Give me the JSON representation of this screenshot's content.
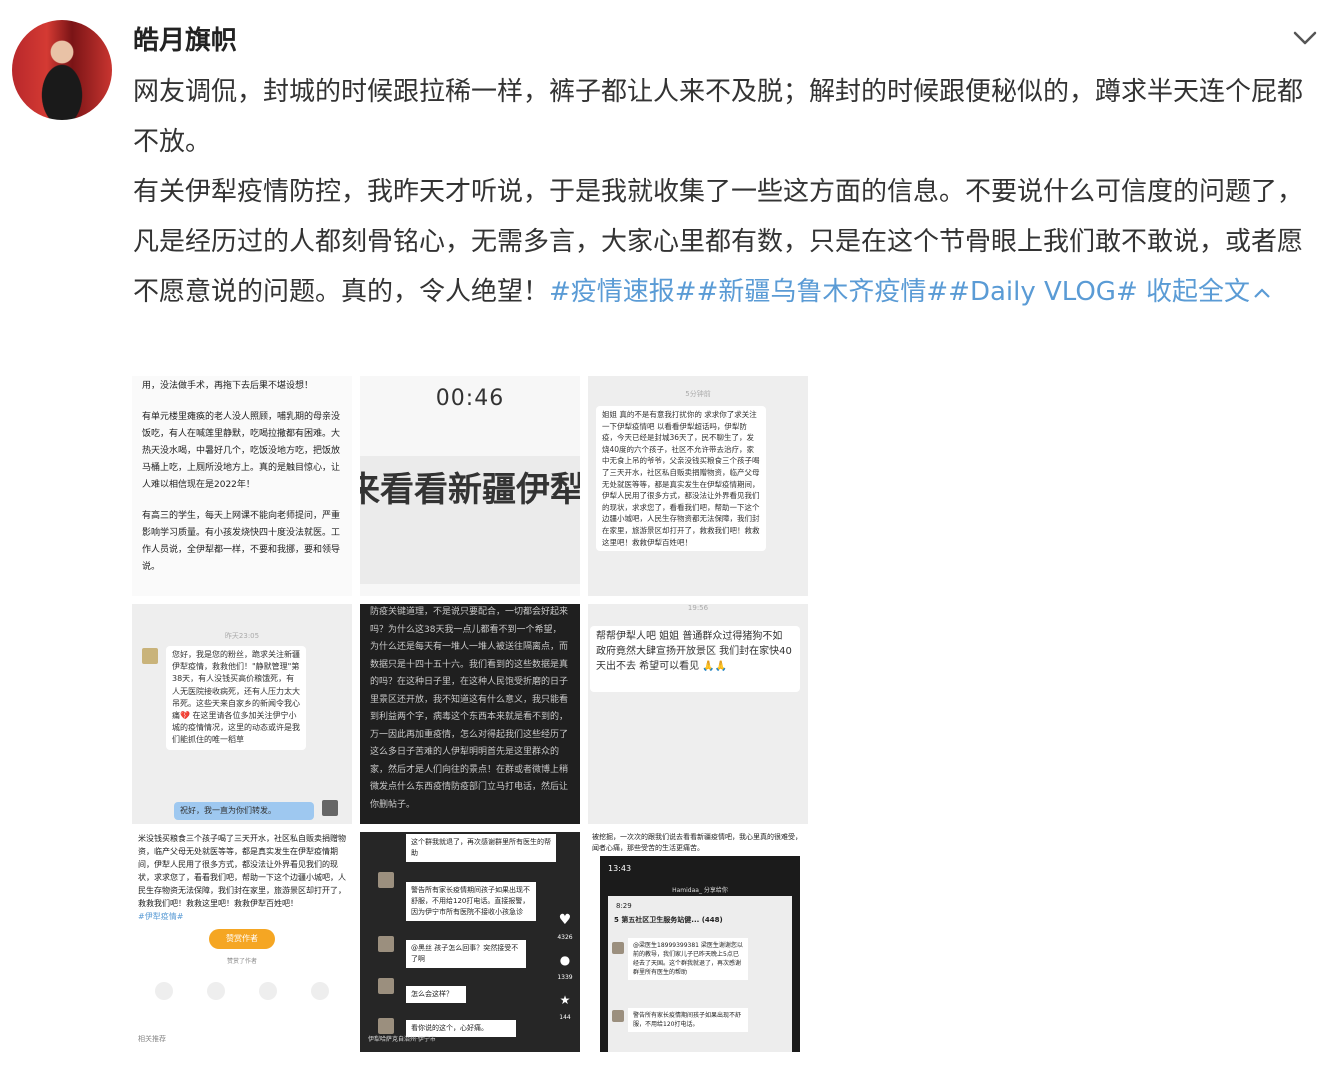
{
  "user": {
    "name": "皓月旗帜"
  },
  "post": {
    "line1": "网友调侃，封城的时候跟拉稀一样，裤子都让人来不及脱；解封的时候跟便秘似的，蹲求半天连个屁都不放。",
    "line2_text": "有关伊犁疫情防控，我昨天才听说，于是我就收集了一些这方面的信息。不要说什么可信度的问题了，凡是经历过的人都刻骨铭心，无需多言，大家心里都有数，只是在这个节骨眼上我们敢不敢说，或者愿不愿意说的问题。真的，令人绝望！",
    "tags": "#疫情速报##新疆乌鲁木齐疫情##Daily VLOG#",
    "collapse_label": "收起全文"
  },
  "images": {
    "img1": {
      "p1": "用，没法做手术，再拖下去后果不堪设想！",
      "p2": "有单元楼里瘫痪的老人没人照顾，哺乳期的母亲没饭吃，有人在喊莲里静默，吃喝拉撒都有困难。大热天没水喝，中暑好几个，吃饭没地方吃，把饭放马桶上吃，上厕所没地方上。真的是触目惊心，让人难以相信现在是2022年！",
      "p3": "有高三的学生，每天上网课不能向老师提问，严重影响学习质量。有小孩发烧快四十度没法就医。工作人员说，全伊犁都一样，不要和我挪，要和领导说。"
    },
    "img2": {
      "time": "00:46",
      "banner": "来看看新疆伊犁"
    },
    "img3": {
      "time": "5分钟前",
      "msg": "姐姐 真的不是有意我打扰你的 求求你了求关注一下伊犁疫情吧 以看看伊犁超话吗，伊犁防疫，今天已经是封城36天了，民不聊生了，发烧40度的六个孩子，社区不允许带去治疗，家中无食上吊的爷爷，父亲没钱买粮食三个孩子喝了三天开水，社区私自贩卖捐赠物资，临产父母无处就医等等，都是真实发生在伊犁疫情期间，伊犁人民用了很多方式，都没法让外界看见我们的现状，求求您了，看看我们吧，帮助一下这个边疆小城吧，人民生存物资都无法保障，我们封在家里，旅游景区却打开了，救救我们吧！救救这里吧！救救伊犁百姓吧！"
    },
    "img4": {
      "time": "昨天23:05",
      "msg": "您好，我是您的粉丝，跪求关注新疆伊犁疫情，救救他们！\"静默管理\"第38天，有人没钱买高价粮饿死，有人无医院接收病死，还有人压力太大吊死。这些天来自家乡的新闻令我心痛💔 在这里请各位多加关注伊宁小城的疫情情况，这里的动态或许是我们能抓住的唯一稻草",
      "reply": "祝好，我一直为你们转发。"
    },
    "img5": {
      "text": "防疫关键道理，不是说只要配合，一切都会好起来吗？为什么这38天我一点儿都看不到一个希望，为什么还是每天有一堆人一堆人被送往隔离点，而数据只是十四十五十六。我们看到的这些数据是真的吗？在这种日子里，在这种人民饱受折磨的日子里景区还开放，我不知道这有什么意义，我只能看到利益两个字，病毒这个东西本来就是看不到的，万一因此再加重疫情，怎么对得起我们这些经历了这么多日子苦难的人伊犁明明首先是这里群众的家，然后才是人们向往的景点！在群或者微博上稍微发点什么东西疫情防疫部门立马打电话，然后让你删帖子。"
    },
    "img6": {
      "time": "19:56",
      "msg": "帮帮伊犁人吧 姐姐 普通群众过得猪狗不如 政府竟然大肆宣扬开放景区 我们封在家快40天出不去 希望可以看见 🙏🙏"
    },
    "img7": {
      "text": "米没钱买粮食三个孩子喝了三天开水，社区私自贩卖捐赠物资，临产父母无处就医等等，都是真实发生在伊犁疫情期间，伊犁人民用了很多方式，都没法让外界看见我们的现状，求求您了，看看我们吧，帮助一下这个边疆小城吧，人民生存物资无法保障，我们封在家里，旅游景区却打开了，救救我们吧！救救这里吧！救救伊犁百姓吧！",
      "tag": "#伊犁疫情#",
      "reward": "赞赏作者",
      "reward_note": "赞赏了作者",
      "related": "相关推荐"
    },
    "img8": {
      "m1": "这个群我就退了，再次感谢群里所有医生的帮助",
      "m2": "警告所有家长疫情期间孩子如果出现不舒服，不用给120打电话。直接报警，因为伊宁市所有医院不接收小孩急诊",
      "m3": "@黑丝 孩子怎么回事？突然接受不了啊",
      "m4": "怎么会这样？",
      "m5": "看你说的这个，心好痛。",
      "location": "伊犁哈萨克自治州·伊宁市",
      "likes": "4326",
      "comments": "1339",
      "favs": "144"
    },
    "img9": {
      "top": "被挖掘，一次次的跟我们说去看看新疆疫情吧，我心里真的很难受，闻者心痛，那些受苦的生活更痛苦。",
      "status_time": "13:43",
      "nav_title": "Hamidaa_ 分享给你",
      "inner_time": "8:29",
      "group": "第五社区卫生服务站健...",
      "group_count": "(448)",
      "back_count": "5",
      "m1": "@梁医生18999399381 梁医生谢谢您以前的教导，我们家儿子已昨天晚上5点已经去了天国。这个群我就退了，再次感谢群里所有医生的帮助",
      "m2": "警告所有家长疫情期间孩子如果出现不舒服，不用给120打电话。"
    }
  },
  "colors": {
    "link": "#5a9bd5",
    "text": "#333333",
    "name": "#222222"
  }
}
